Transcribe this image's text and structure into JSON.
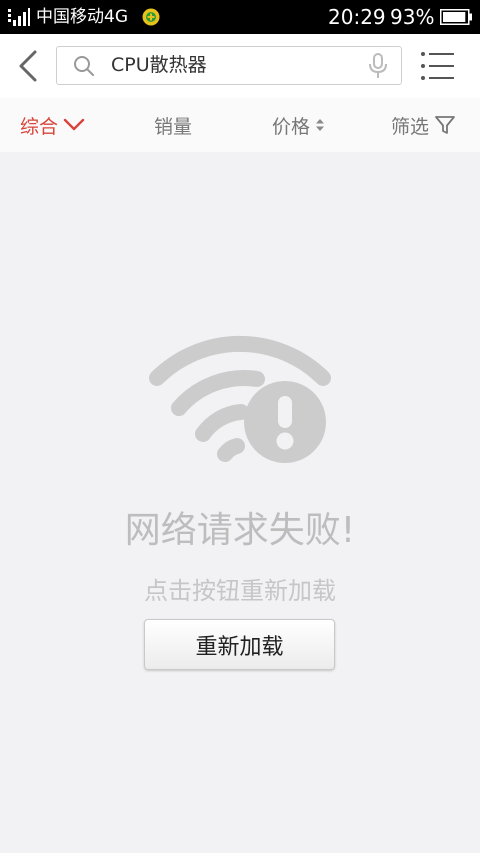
{
  "status_bar": {
    "carrier": "中国移动4G",
    "time": "20:29",
    "battery_percent": "93%",
    "battery_level": 0.93,
    "icons": [
      "signal-icon",
      "network-badge-icon",
      "battery-icon"
    ]
  },
  "header": {
    "search": {
      "value": "CPU散热器"
    },
    "icons": [
      "back-arrow-icon",
      "search-icon",
      "microphone-icon",
      "list-menu-icon"
    ]
  },
  "tabs": [
    {
      "label": "综合",
      "active": true,
      "icon": "chevron-down-icon"
    },
    {
      "label": "销量",
      "active": false
    },
    {
      "label": "价格",
      "active": false,
      "icon": "sort-updown-icon"
    },
    {
      "label": "筛选",
      "active": false,
      "icon": "filter-funnel-icon"
    }
  ],
  "error": {
    "icon": "wifi-error-icon",
    "title": "网络请求失败!",
    "subtitle": "点击按钮重新加载",
    "button_label": "重新加载"
  },
  "colors": {
    "accent": "#d9443a",
    "background": "#f2f2f4",
    "icon_gray": "#cccccc"
  }
}
